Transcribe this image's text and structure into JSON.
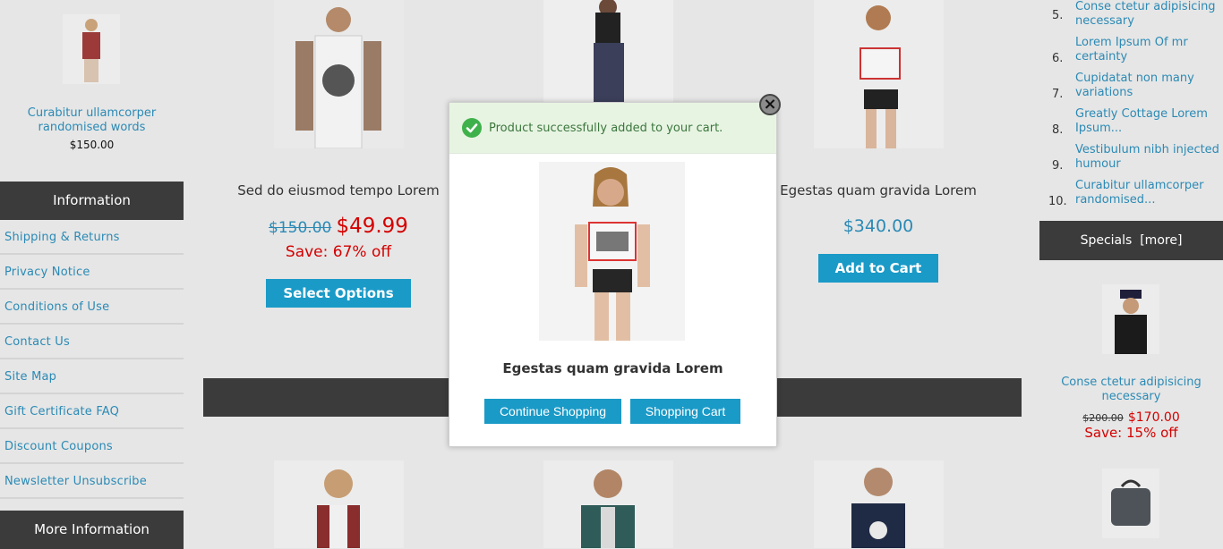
{
  "left": {
    "top_product": {
      "title": "Curabitur ullamcorper randomised words",
      "price": "$150.00"
    },
    "information_title": "Information",
    "information_links": [
      "Shipping & Returns",
      "Privacy Notice",
      "Conditions of Use",
      "Contact Us",
      "Site Map",
      "Gift Certificate FAQ",
      "Discount Coupons",
      "Newsletter Unsubscribe"
    ],
    "more_information_title": "More Information"
  },
  "center": {
    "product1": {
      "title": "Sed do eiusmod tempo Lorem",
      "old_price": "$150.00",
      "new_price": "$49.99",
      "save": "Save: 67% off",
      "button": "Select Options"
    },
    "product3": {
      "title": "Egestas quam gravida Lorem",
      "price": "$340.00",
      "button": "Add to Cart"
    }
  },
  "right": {
    "list": [
      {
        "num": "5.",
        "title": "Conse ctetur adipisicing necessary"
      },
      {
        "num": "6.",
        "title": "Lorem Ipsum Of mr certainty"
      },
      {
        "num": "7.",
        "title": "Cupidatat non many variations"
      },
      {
        "num": "8.",
        "title": "Greatly Cottage Lorem Ipsum..."
      },
      {
        "num": "9.",
        "title": "Vestibulum nibh injected humour"
      },
      {
        "num": "10.",
        "title": "Curabitur ullamcorper randomised..."
      }
    ],
    "specials_title": "Specials",
    "specials_more": "[more]",
    "special_product": {
      "title": "Conse ctetur adipisicing necessary",
      "old_price": "$200.00",
      "new_price": "$170.00",
      "save": "Save: 15% off"
    }
  },
  "modal": {
    "message": "Product successfully added to your cart.",
    "product_name": "Egestas quam gravida Lorem",
    "continue_button": "Continue Shopping",
    "cart_button": "Shopping Cart",
    "close_symbol": "×"
  },
  "colors": {
    "accent": "#1a9ac7",
    "link": "#2b8ab5",
    "sale": "#d40000",
    "dark_header": "#3b3b3b",
    "success_bg": "#e7f4e2",
    "success_text": "#3c763d"
  }
}
